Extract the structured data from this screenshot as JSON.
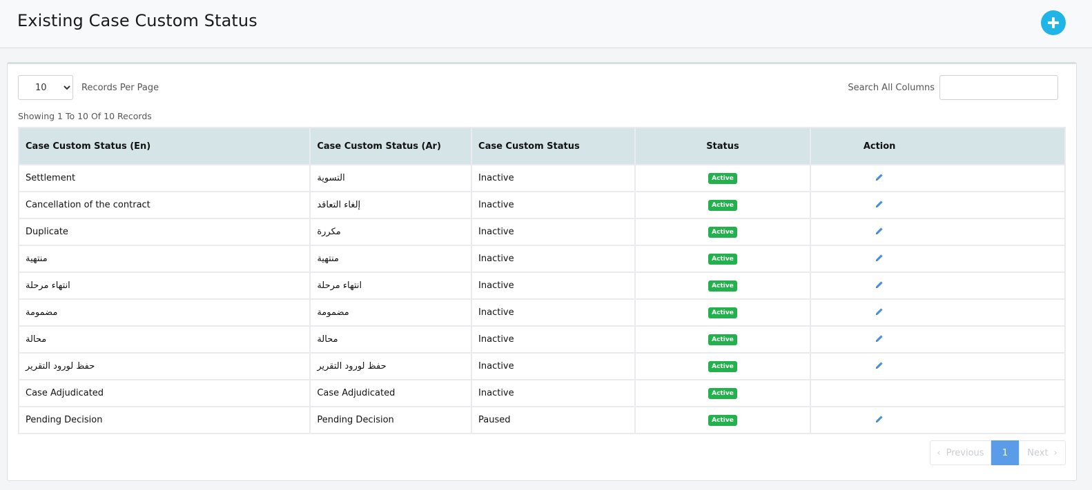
{
  "header": {
    "title": "Existing Case Custom Status"
  },
  "controls": {
    "per_page_value": "10",
    "per_page_options": [
      "10"
    ],
    "per_page_label": "Records Per Page",
    "search_label": "Search All Columns",
    "search_value": ""
  },
  "showing_text": "Showing 1 To 10 Of 10 Records",
  "table": {
    "headers": [
      "Case Custom Status (En)",
      "Case Custom Status (Ar)",
      "Case Custom Status",
      "Status",
      "Action"
    ],
    "rows": [
      {
        "en": "Settlement",
        "ar": "التسوية",
        "custom": "Inactive",
        "status": "Active",
        "editable": true
      },
      {
        "en": "Cancellation of the contract",
        "ar": "إلغاء التعاقد",
        "custom": "Inactive",
        "status": "Active",
        "editable": true
      },
      {
        "en": "Duplicate",
        "ar": "مكررة",
        "custom": "Inactive",
        "status": "Active",
        "editable": true
      },
      {
        "en": "منتهية",
        "ar": "منتهية",
        "custom": "Inactive",
        "status": "Active",
        "editable": true
      },
      {
        "en": "انتهاء مرحلة",
        "ar": "انتهاء مرحلة",
        "custom": "Inactive",
        "status": "Active",
        "editable": true
      },
      {
        "en": "مضمومة",
        "ar": "مضمومة",
        "custom": "Inactive",
        "status": "Active",
        "editable": true
      },
      {
        "en": "محالة",
        "ar": "محالة",
        "custom": "Inactive",
        "status": "Active",
        "editable": true
      },
      {
        "en": "حفظ لورود التقرير",
        "ar": "حفظ لورود التقرير",
        "custom": "Inactive",
        "status": "Active",
        "editable": true
      },
      {
        "en": "Case Adjudicated",
        "ar": "Case Adjudicated",
        "custom": "Inactive",
        "status": "Active",
        "editable": false
      },
      {
        "en": "Pending Decision",
        "ar": "Pending Decision",
        "custom": "Paused",
        "status": "Active",
        "editable": true
      }
    ]
  },
  "pagination": {
    "prev": "Previous",
    "current": "1",
    "next": "Next"
  },
  "colors": {
    "accent": "#1fb5e6",
    "badge": "#22b14c",
    "header_bg": "#d5e4e7",
    "page_active": "#5b9ce8",
    "edit_icon": "#4a8ee0"
  },
  "icons": {
    "add": "plus-circle-icon",
    "edit": "pencil-icon",
    "prev": "chevron-left-icon",
    "next": "chevron-right-icon"
  }
}
